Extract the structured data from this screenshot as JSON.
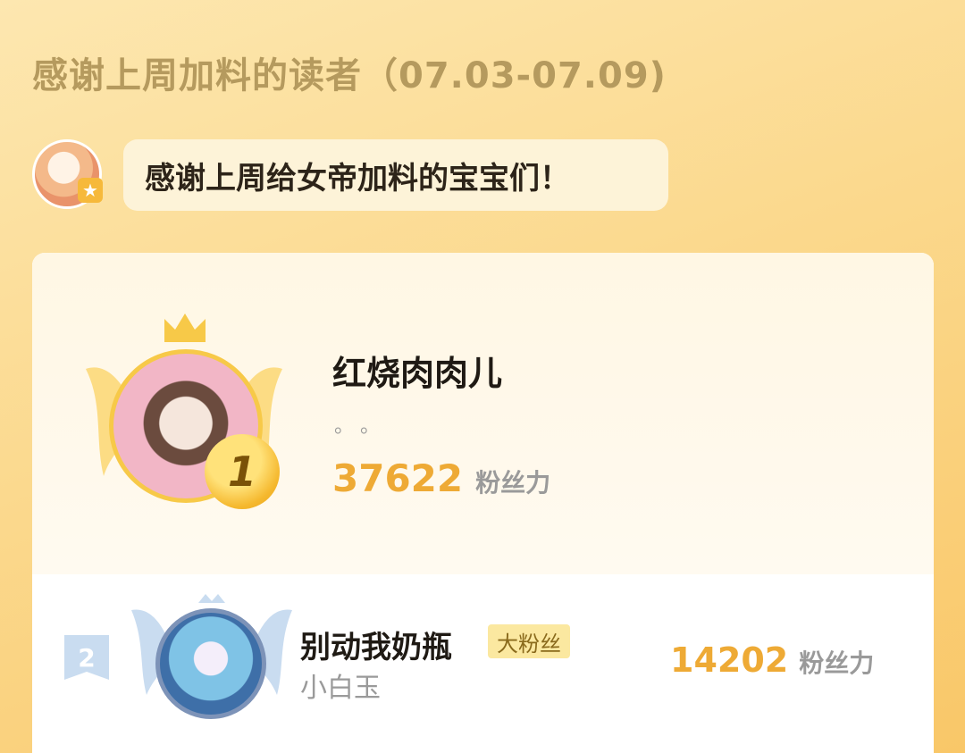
{
  "header": {
    "title": "感谢上周加料的读者（07.03-07.09)"
  },
  "host": {
    "avatar_icon": "anime-girl-avatar-icon",
    "badge_icon": "star-badge-icon",
    "message": "感谢上周给女帝加料的宝宝们！"
  },
  "leaderboard": {
    "first": {
      "rank": "1",
      "name": "红烧肉肉儿",
      "signature": "。。",
      "score": "37622",
      "unit": "粉丝力"
    },
    "second": {
      "rank": "2",
      "name": "别动我奶瓶",
      "badge": "大粉丝",
      "subtitle": "小白玉",
      "score": "14202",
      "unit": "粉丝力"
    }
  },
  "colors": {
    "accent_score": "#eeaa35",
    "gold": "#f7c948",
    "silver_tag": "#c9dcf0"
  }
}
